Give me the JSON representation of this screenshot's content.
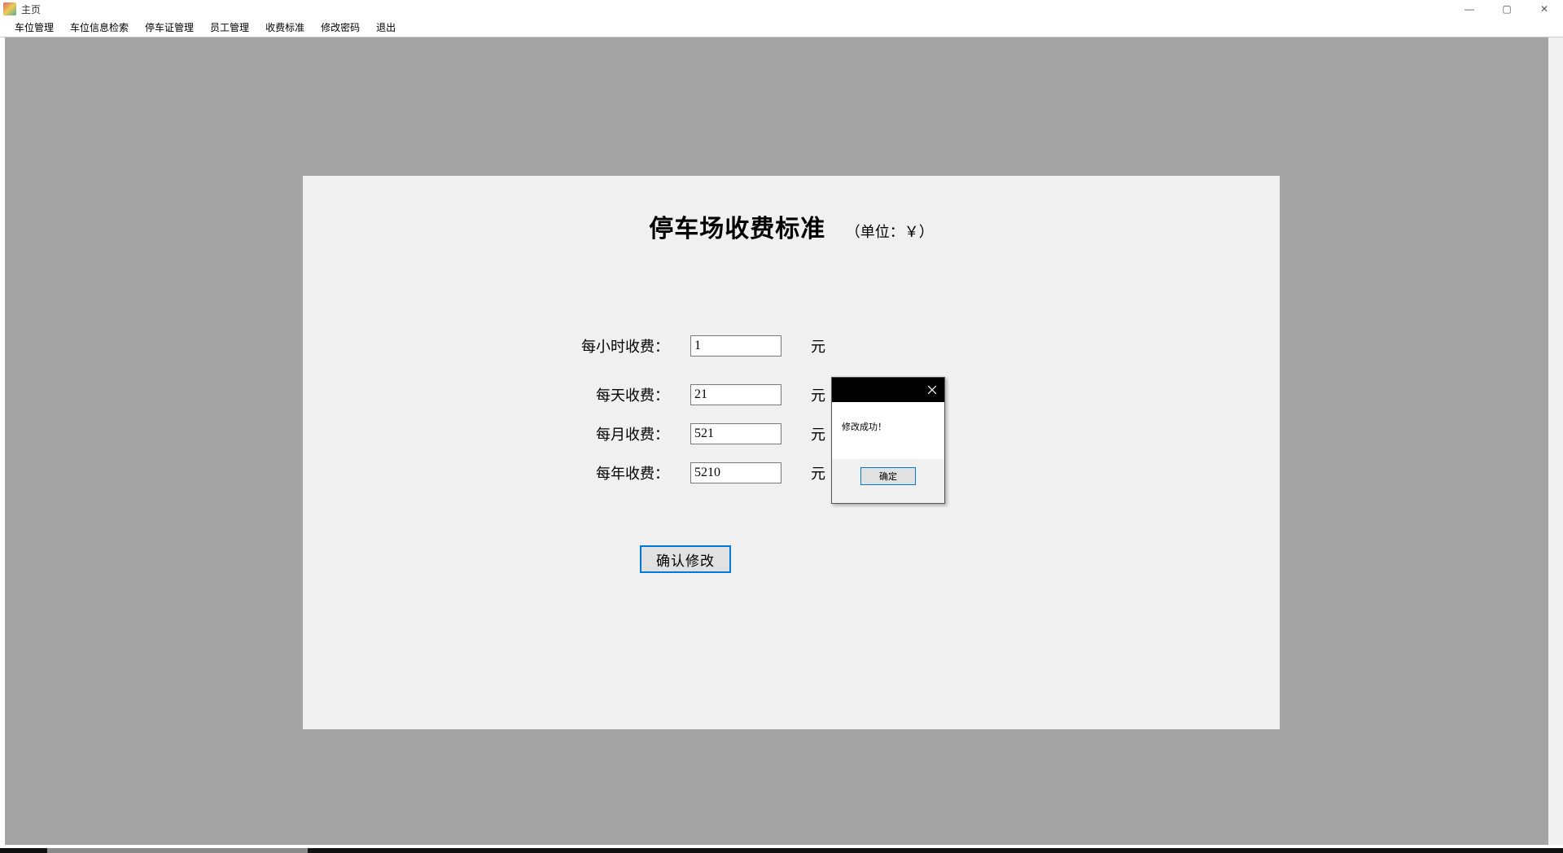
{
  "window": {
    "title": "主页",
    "controls": {
      "minimize": "—",
      "maximize": "▢",
      "close": "✕"
    }
  },
  "menu": [
    "车位管理",
    "车位信息检索",
    "停车证管理",
    "员工管理",
    "收费标准",
    "修改密码",
    "退出"
  ],
  "panel": {
    "title": "停车场收费标准",
    "unit": "（单位：￥）",
    "rows": [
      {
        "label": "每小时收费：",
        "value": "1",
        "suffix": "元"
      },
      {
        "label": "每天收费：",
        "value": "21",
        "suffix": "元"
      },
      {
        "label": "每月收费：",
        "value": "521",
        "suffix": "元"
      },
      {
        "label": "每年收费：",
        "value": "5210",
        "suffix": "元"
      }
    ],
    "confirm": "确认修改"
  },
  "dialog": {
    "message": "修改成功！",
    "ok": "确定"
  }
}
